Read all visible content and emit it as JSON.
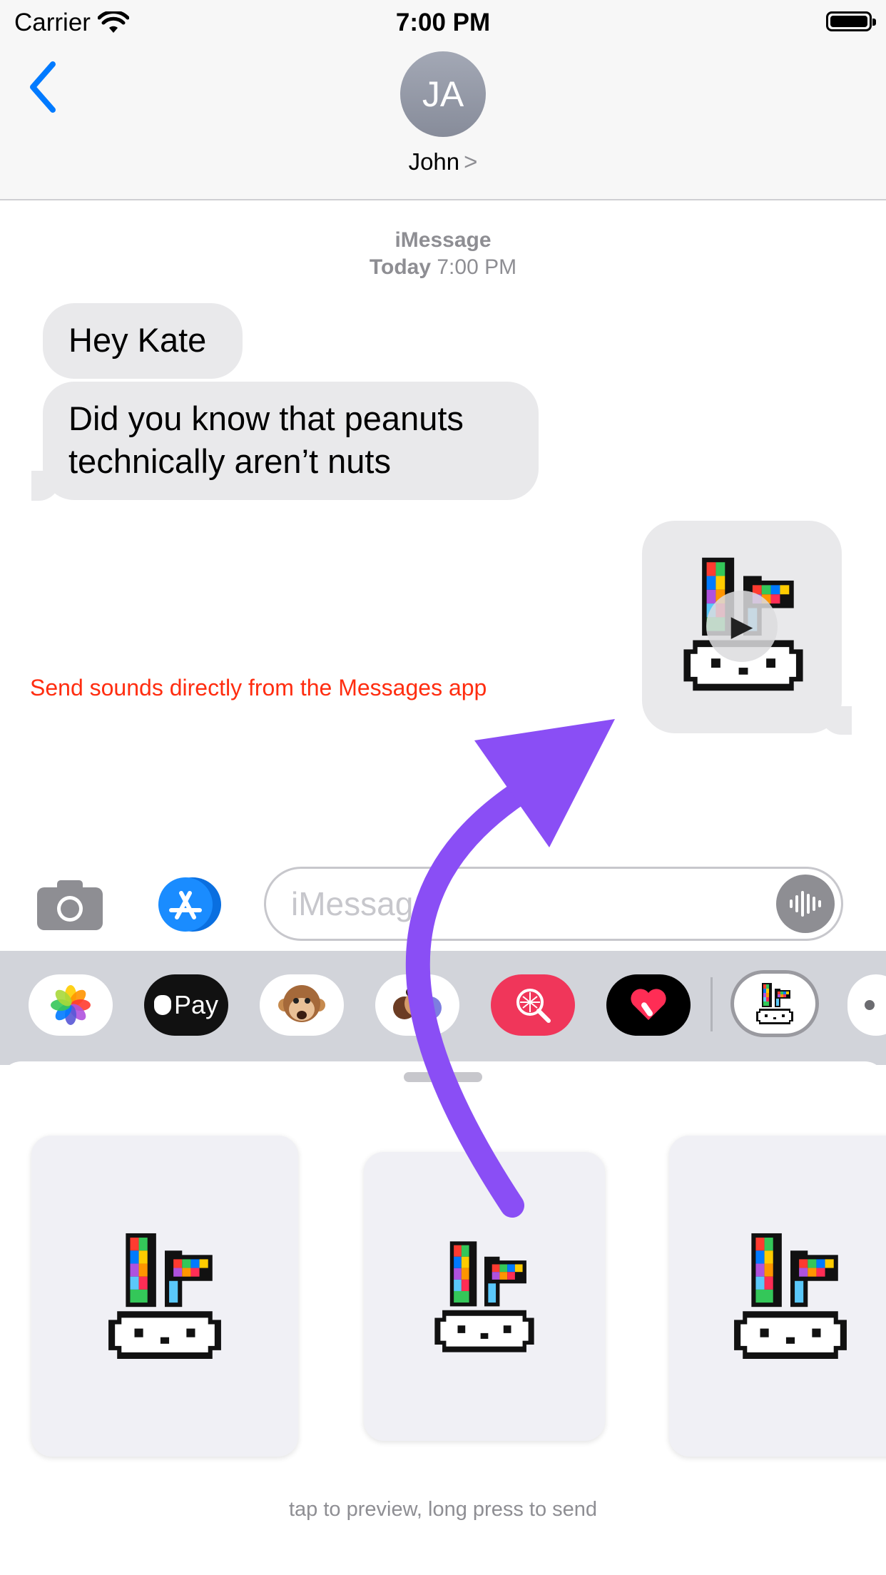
{
  "status_bar": {
    "carrier": "Carrier",
    "time": "7:00 PM"
  },
  "header": {
    "avatar_initials": "JA",
    "contact_name": "John",
    "contact_chevron": ">"
  },
  "conversation": {
    "service": "iMessage",
    "date_bold": "Today",
    "date_time": "7:00 PM",
    "messages": [
      {
        "text": "Hey Kate"
      },
      {
        "text": "Did you know that peanuts technically aren’t nuts"
      }
    ]
  },
  "promo_text": "Send sounds directly from the Messages app",
  "input": {
    "placeholder": "iMessage"
  },
  "app_drawer": {
    "apps": [
      "photos-app",
      "apple-pay-app",
      "animoji-app",
      "memoji-app",
      "search-images-app",
      "digital-touch-app",
      "bunny-sounds-app",
      "more-apps"
    ],
    "apple_pay_label": "Pay"
  },
  "sticker_panel": {
    "hint": "tap to preview, long press to send"
  },
  "colors": {
    "accent": "#007aff",
    "arrow": "#8a4ef5",
    "promo": "#ff2d10",
    "bubble": "#e9e9eb"
  }
}
